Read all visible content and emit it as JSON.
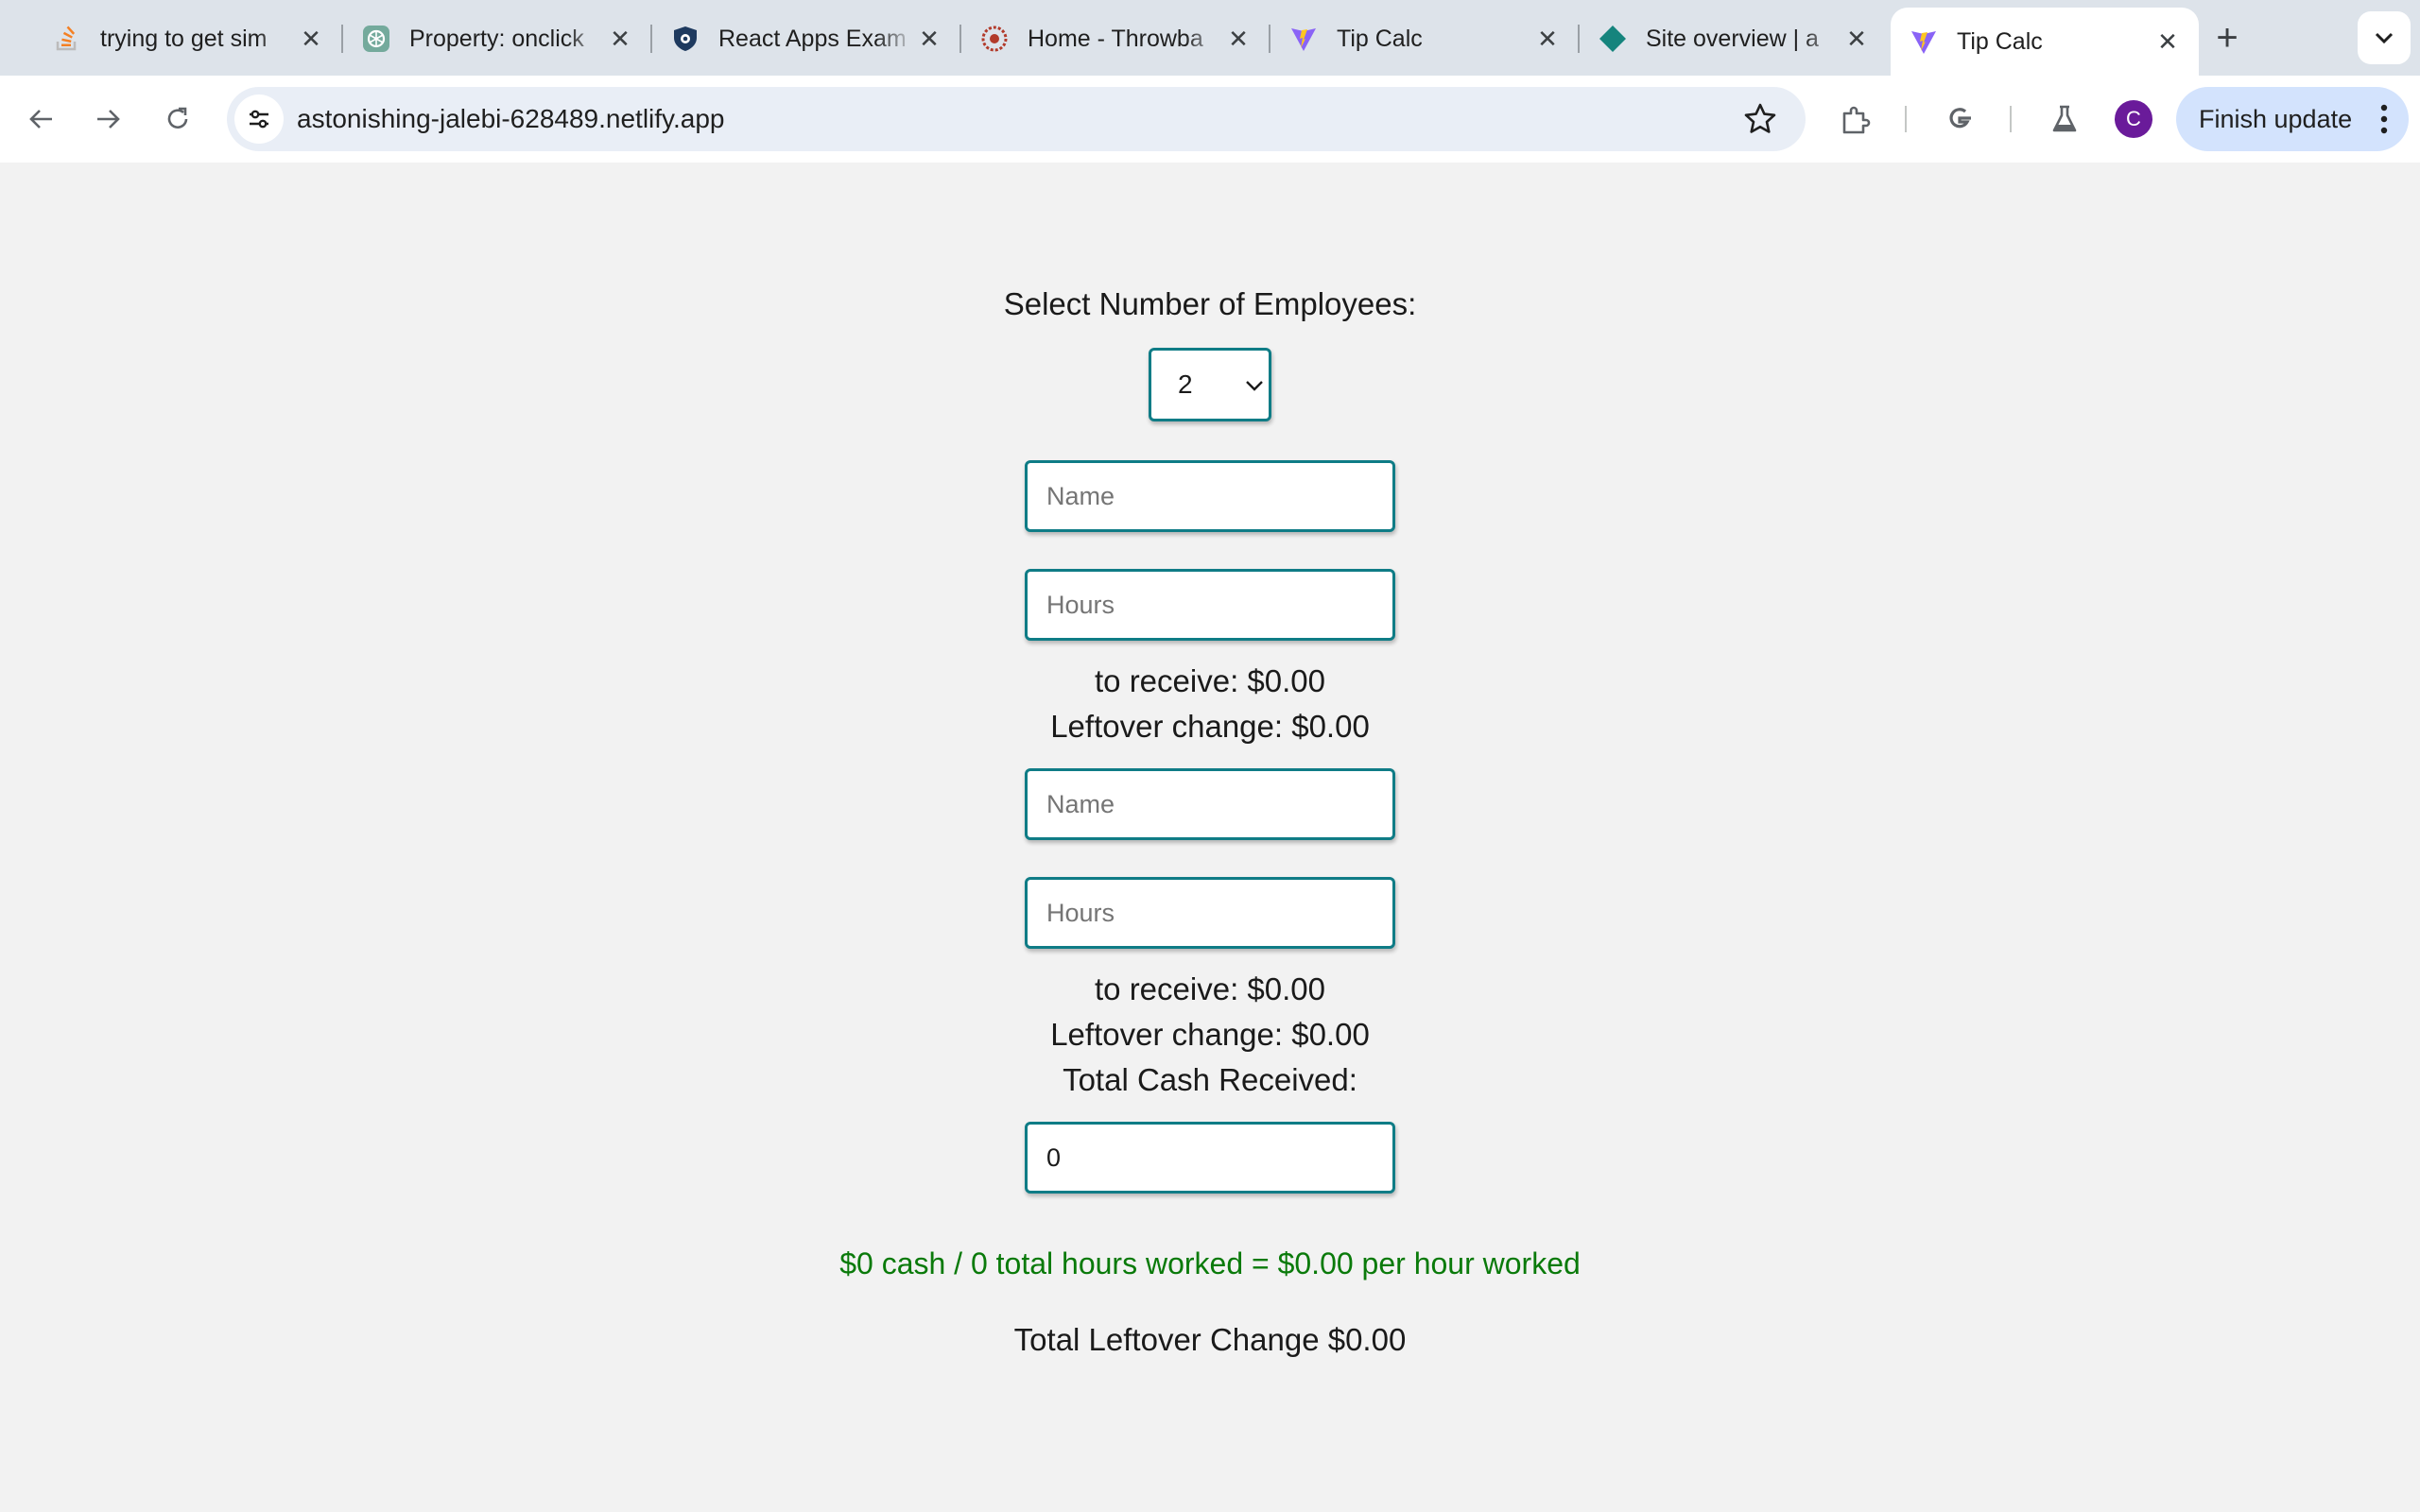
{
  "browser": {
    "tabs": [
      {
        "title": "trying to get sim",
        "icon": "stackoverflow-icon"
      },
      {
        "title": "Property: onclick",
        "icon": "chatgpt-icon"
      },
      {
        "title": "React Apps Exam",
        "icon": "shield-icon"
      },
      {
        "title": "Home - Throwba",
        "icon": "sunburst-icon"
      },
      {
        "title": "Tip Calc",
        "icon": "vite-icon"
      },
      {
        "title": "Site overview | a",
        "icon": "netlify-icon"
      },
      {
        "title": "Tip Calc",
        "icon": "vite-icon",
        "active": true
      }
    ],
    "url": "astonishing-jalebi-628489.netlify.app",
    "profile_initial": "C",
    "finish_update_label": "Finish update"
  },
  "app": {
    "employee_select_label": "Select Number of Employees:",
    "employee_count": "2",
    "employees": [
      {
        "name_placeholder": "Name",
        "hours_placeholder": "Hours",
        "receive_text": "to receive: $0.00",
        "leftover_text": "Leftover change: $0.00"
      },
      {
        "name_placeholder": "Name",
        "hours_placeholder": "Hours",
        "receive_text": "to receive: $0.00",
        "leftover_text": "Leftover change: $0.00"
      }
    ],
    "total_cash_label": "Total Cash Received:",
    "total_cash_value": "0",
    "rate_summary": "$0 cash / 0 total hours worked = $0.00 per hour worked",
    "total_leftover": "Total Leftover Change $0.00"
  },
  "colors": {
    "accent_border": "#0f7c86",
    "summary_green": "#0a7a0a",
    "page_bg": "#f2f2f2"
  }
}
